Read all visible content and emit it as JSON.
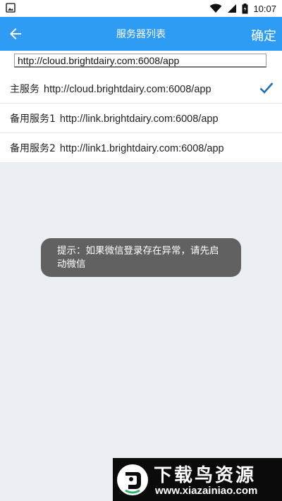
{
  "status_bar": {
    "time": "10:07"
  },
  "app_bar": {
    "title": "服务器列表",
    "confirm_label": "确定"
  },
  "url_input": {
    "value": "http://cloud.brightdairy.com:6008/app"
  },
  "servers": [
    {
      "name": "主服务",
      "url": "http://cloud.brightdairy.com:6008/app",
      "selected": true
    },
    {
      "name": "备用服务1",
      "url": "http://link.brightdairy.com:6008/app",
      "selected": false
    },
    {
      "name": "备用服务2",
      "url": "http://link1.brightdairy.com:6008/app",
      "selected": false
    }
  ],
  "toast": {
    "text": "提示：如果微信登录存在异常，请先启动微信"
  },
  "watermark": {
    "title": "下载鸟资源",
    "url": "www.xiazainiao.com"
  },
  "colors": {
    "primary": "#2d9cf2",
    "check": "#1e6fb5",
    "background": "#ebeef2"
  }
}
